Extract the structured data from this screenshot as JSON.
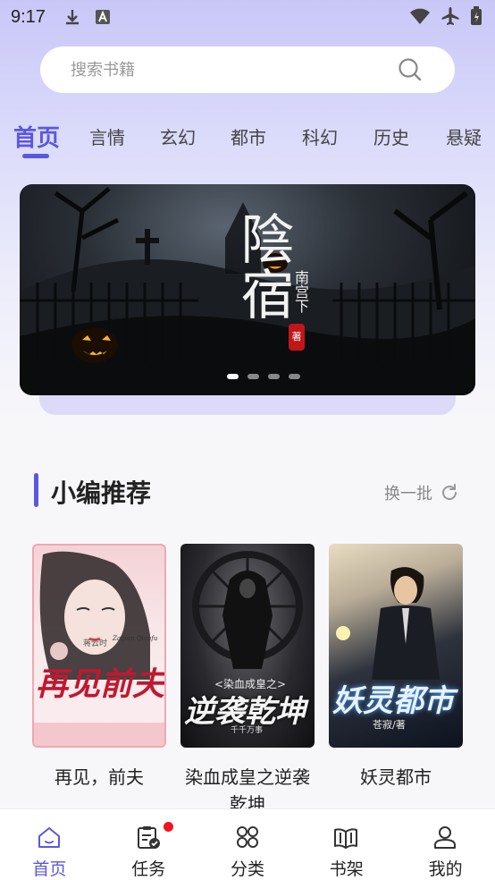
{
  "status_bar": {
    "time": "9:17"
  },
  "search": {
    "placeholder": "搜索书籍"
  },
  "tabs": [
    {
      "label": "首页",
      "active": true
    },
    {
      "label": "言情"
    },
    {
      "label": "玄幻"
    },
    {
      "label": "都市"
    },
    {
      "label": "科幻"
    },
    {
      "label": "历史"
    },
    {
      "label": "悬疑"
    }
  ],
  "banner": {
    "title": "陰宿",
    "author": "南宫下",
    "seal": "著",
    "active_slide": 1,
    "slide_count": 4
  },
  "section": {
    "title": "小编推荐",
    "refresh_label": "换一批"
  },
  "books": [
    {
      "title": "再见，前夫",
      "cover_text": "再见前夫",
      "cover_author": "蒋云时",
      "cover_subtitle": "Zaijian Qianfu"
    },
    {
      "title": "染血成皇之逆袭乾坤",
      "cover_text": "逆袭乾坤",
      "cover_subtitle": "<染血成皇之>",
      "cover_author": "千千万事"
    },
    {
      "title": "妖灵都市",
      "cover_text": "妖灵都市",
      "cover_author": "苍寂/著"
    }
  ],
  "bottom_nav": [
    {
      "label": "首页",
      "icon": "home-icon",
      "active": true
    },
    {
      "label": "任务",
      "icon": "task-clipboard-icon",
      "badge": true
    },
    {
      "label": "分类",
      "icon": "category-grid-icon"
    },
    {
      "label": "书架",
      "icon": "bookshelf-icon"
    },
    {
      "label": "我的",
      "icon": "profile-icon"
    }
  ],
  "colors": {
    "accent": "#5b57e0",
    "badge": "#f2151b",
    "header_bg": "#c9c7f7"
  }
}
